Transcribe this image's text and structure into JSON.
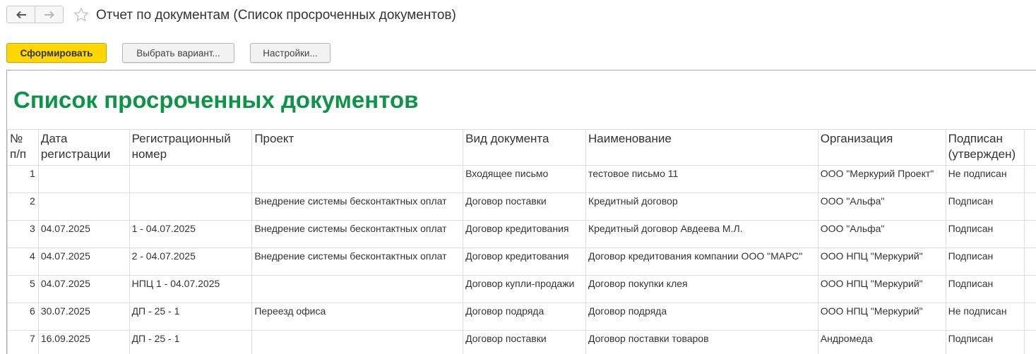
{
  "header": {
    "title": "Отчет по документам (Список просроченных документов)",
    "icons": {
      "back": "arrow-left-icon",
      "forward": "arrow-right-icon",
      "favorite": "star-icon"
    }
  },
  "toolbar": {
    "generate_label": "Сформировать",
    "choose_variant_label": "Выбрать вариант...",
    "settings_label": "Настройки..."
  },
  "colors": {
    "accent_yellow": "#ffd700",
    "title_green": "#0e9447"
  },
  "report": {
    "title": "Список просроченных документов",
    "columns": [
      "№ п/п",
      "Дата регистрации",
      "Регистрационный номер",
      "Проект",
      "Вид документа",
      "Наименование",
      "Организация",
      "Подписан (утвержден)"
    ],
    "rows": [
      [
        "1",
        "",
        "",
        "",
        "Входящее письмо",
        "тестовое письмо 11",
        "ООО \"Меркурий Проект\"",
        "Не подписан"
      ],
      [
        "2",
        "",
        "",
        "Внедрение системы бесконтактных оплат",
        "Договор поставки",
        "Кредитный договор",
        "ООО \"Альфа\"",
        "Подписан"
      ],
      [
        "3",
        "04.07.2025",
        "1 - 04.07.2025",
        "Внедрение системы бесконтактных оплат",
        "Договор кредитования",
        "Кредитный договор Авдеева М.Л.",
        "ООО \"Альфа\"",
        "Подписан"
      ],
      [
        "4",
        "04.07.2025",
        "2 - 04.07.2025",
        "Внедрение системы бесконтактных оплат",
        "Договор кредитования",
        "Договор кредитования компании ООО \"МАРС\"",
        "ООО НПЦ \"Меркурий\"",
        "Подписан"
      ],
      [
        "5",
        "04.07.2025",
        "НПЦ 1 - 04.07.2025",
        "",
        "Договор купли-продажи",
        "Договор покупки клея",
        "ООО НПЦ \"Меркурий\"",
        "Подписан"
      ],
      [
        "6",
        "30.07.2025",
        "ДП - 25 - 1",
        "Переезд офиса",
        "Договор подряда",
        "Договор подряда",
        "ООО НПЦ \"Меркурий\"",
        "Не подписан"
      ],
      [
        "7",
        "16.09.2025",
        "ДП - 25 - 1",
        "",
        "Договор поставки",
        "Договор поставки товаров",
        "Андромеда",
        "Подписан"
      ]
    ]
  }
}
